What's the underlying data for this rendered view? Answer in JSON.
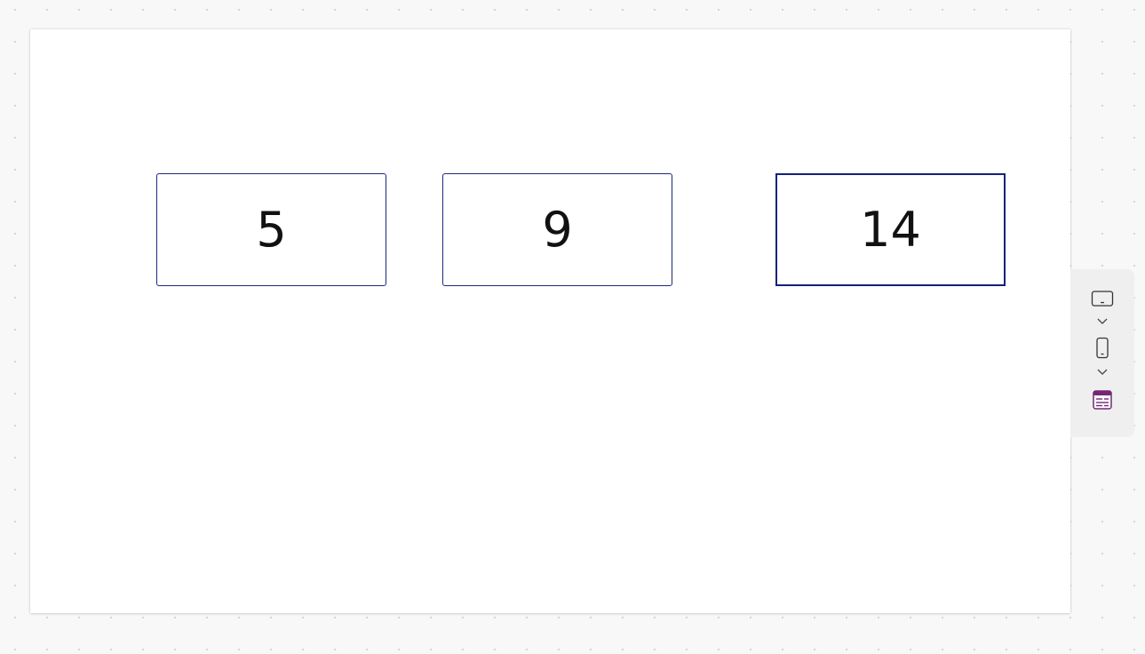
{
  "canvas": {
    "boxes": [
      {
        "value": "5"
      },
      {
        "value": "9"
      },
      {
        "value": "14"
      }
    ]
  },
  "toolbar": {
    "icons": [
      "tablet-landscape-icon",
      "chevron-down-icon",
      "phone-portrait-icon",
      "chevron-down-icon",
      "form-layout-icon"
    ],
    "accent_color": "#742774"
  }
}
